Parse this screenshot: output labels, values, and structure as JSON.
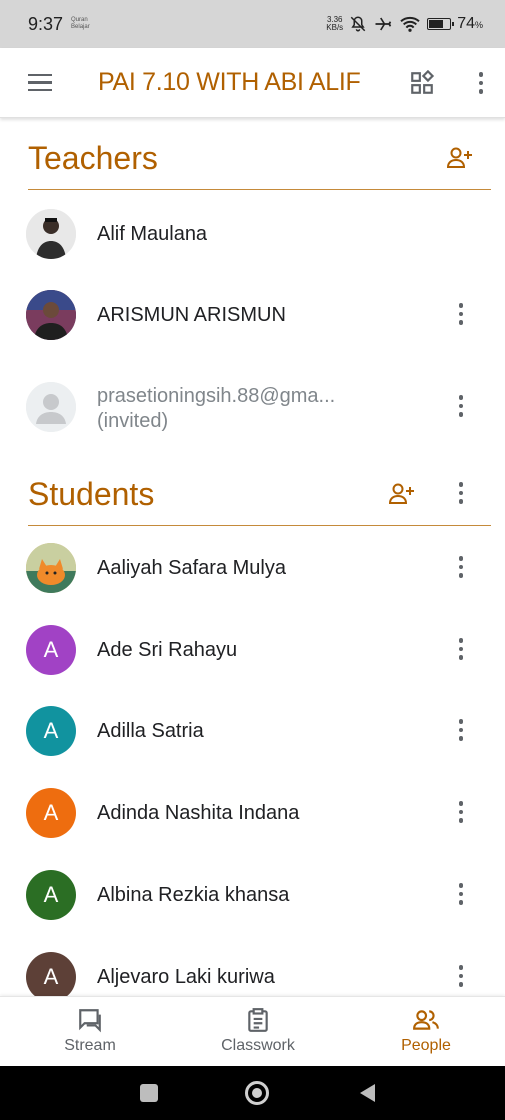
{
  "status_bar": {
    "time": "9:37",
    "app_hint": "Quran Belajar",
    "net_speed_value": "3.36",
    "net_speed_unit": "KB/s",
    "battery_percent": "74",
    "battery_percent_sign": "%",
    "battery_level": 0.74,
    "icons": [
      "bell-off-icon",
      "airplane-icon",
      "wifi-icon",
      "battery-charging-icon"
    ]
  },
  "app_bar": {
    "class_title": "PAI 7.10 WITH ABI ALIF",
    "icons": [
      "menu-icon",
      "class-view-icon",
      "more-vert-icon"
    ]
  },
  "teachers": {
    "title": "Teachers",
    "items": [
      {
        "name": "Alif Maulana",
        "avatar": "photo",
        "menu": false
      },
      {
        "name": "ARISMUN ARISMUN",
        "avatar": "photo",
        "menu": true
      },
      {
        "name": "prasetioningsih.88@gma...",
        "status": "(invited)",
        "avatar": "placeholder",
        "menu": true
      }
    ]
  },
  "students": {
    "title": "Students",
    "items": [
      {
        "name": "Aaliyah Safara Mulya",
        "avatar": "photo",
        "menu": true
      },
      {
        "name": "Ade Sri Rahayu",
        "initial": "A",
        "avatar_color": "#a142c5",
        "menu": true
      },
      {
        "name": "Adilla Satria",
        "initial": "A",
        "avatar_color": "#11939f",
        "menu": true
      },
      {
        "name": "Adinda Nashita Indana",
        "initial": "A",
        "avatar_color": "#ee6d0f",
        "menu": true
      },
      {
        "name": "Albina Rezkia khansa",
        "initial": "A",
        "avatar_color": "#2b6e24",
        "menu": true
      },
      {
        "name": "Aljevaro Laki kuriwa",
        "initial": "A",
        "avatar_color": "#5d4037",
        "menu": true
      }
    ]
  },
  "bottom_nav": {
    "items": [
      {
        "label": "Stream",
        "icon": "stream-icon",
        "active": false
      },
      {
        "label": "Classwork",
        "icon": "classwork-icon",
        "active": false
      },
      {
        "label": "People",
        "icon": "people-icon",
        "active": true
      }
    ]
  },
  "colors": {
    "accent": "#b06000",
    "divider": "#c58a3a",
    "icon_gray": "#5f6368"
  }
}
